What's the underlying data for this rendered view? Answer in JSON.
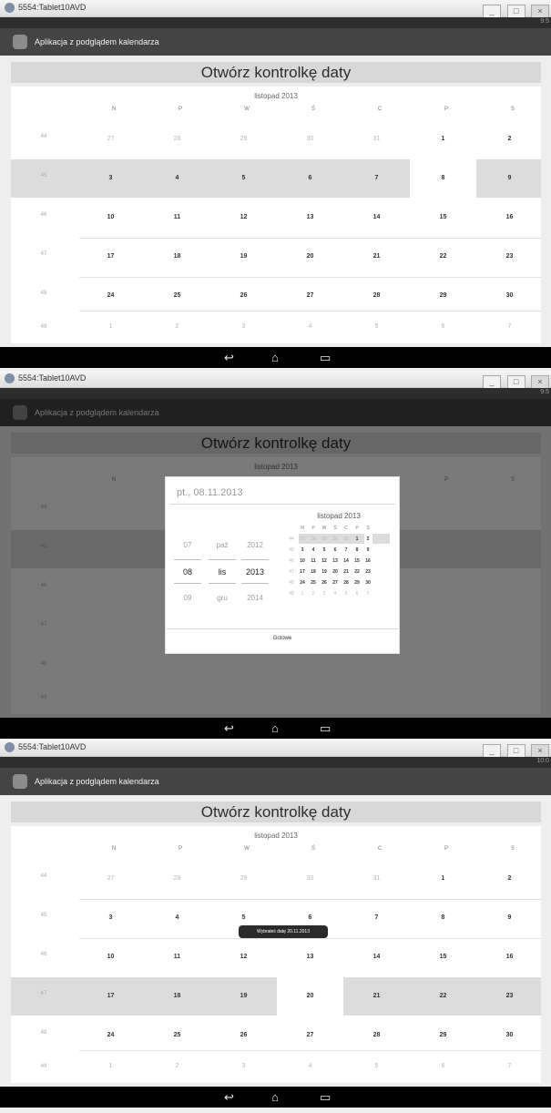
{
  "window": {
    "title": "5554:Tablet10AVD"
  },
  "status": {
    "time_1": "9:5",
    "time_2": "9:5",
    "time_3": "10:0"
  },
  "app": {
    "title": "Aplikacja z podglądem kalendarza"
  },
  "button": {
    "label": "Otwórz kontrolkę daty"
  },
  "calendar": {
    "month": "listopad 2013",
    "days_of_week": [
      "N",
      "P",
      "W",
      "Ś",
      "C",
      "P",
      "S"
    ],
    "weeks": [
      {
        "num": "44",
        "days": [
          "27",
          "28",
          "29",
          "30",
          "31",
          "1",
          "2"
        ]
      },
      {
        "num": "45",
        "days": [
          "3",
          "4",
          "5",
          "6",
          "7",
          "8",
          "9"
        ]
      },
      {
        "num": "46",
        "days": [
          "10",
          "11",
          "12",
          "13",
          "14",
          "15",
          "16"
        ]
      },
      {
        "num": "47",
        "days": [
          "17",
          "18",
          "19",
          "20",
          "21",
          "22",
          "23"
        ]
      },
      {
        "num": "48",
        "days": [
          "24",
          "25",
          "26",
          "27",
          "28",
          "29",
          "30"
        ]
      },
      {
        "num": "49",
        "days": [
          "1",
          "2",
          "3",
          "4",
          "5",
          "6",
          "7"
        ]
      }
    ]
  },
  "dialog": {
    "header": "pt., 08.11.2013",
    "day_values": [
      "07",
      "08",
      "09"
    ],
    "month_values": [
      "paź",
      "lis",
      "gru"
    ],
    "year_values": [
      "2012",
      "2013",
      "2014"
    ],
    "month": "listopad 2013",
    "done": "Gotowe"
  },
  "toast": {
    "text": "Wybrałeś datę 20.11.2013"
  },
  "icons": {
    "window": "emulator-icon",
    "app": "android-app-icon",
    "back": "back-icon",
    "home": "home-icon",
    "recents": "recent-apps-icon"
  },
  "colors": {
    "selected_week": "#dcdcdc",
    "selected_day": "#ffffff",
    "dialog_dim": "#000000"
  }
}
